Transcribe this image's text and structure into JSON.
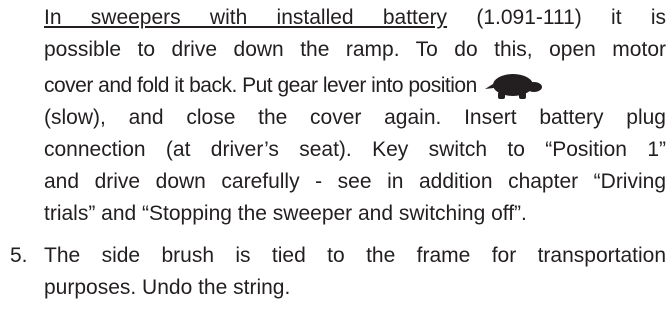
{
  "paragraph_intro": {
    "underlined": "In sweepers with installed battery",
    "rest_line1": " (1.091-111) it is",
    "line2": "possible to drive down the ramp. To do this, open motor",
    "line3": "cover and fold it back. Put gear lever into position",
    "line4": "(slow), and close the cover again. Insert battery plug",
    "line5": "connection (at driver’s seat). Key switch to “Position 1”",
    "line6": "and drive down carefully - see in addition chapter “Driving",
    "line7": "trials” and “Stopping the sweeper and switching off”."
  },
  "item5": {
    "number": "5.",
    "line1": "The side brush is tied to the frame for transportation",
    "line2": "purposes. Undo the string."
  },
  "icons": {
    "gear_position": "turtle-icon"
  },
  "colors": {
    "text": "#231f20",
    "background": "#ffffff"
  }
}
